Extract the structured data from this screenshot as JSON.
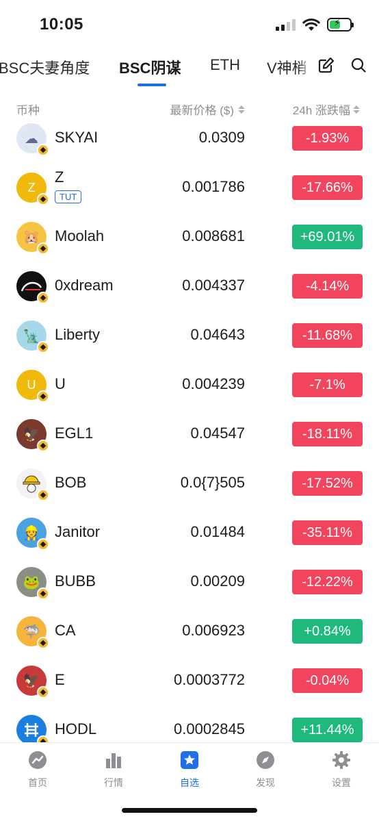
{
  "status_bar": {
    "time": "10:05",
    "battery_color": "#34c759"
  },
  "tabs": [
    {
      "label": "BSC夫妻角度",
      "active": false
    },
    {
      "label": "BSC阴谋",
      "active": true
    },
    {
      "label": "ETH",
      "active": false
    },
    {
      "label": "V神梢",
      "active": false
    }
  ],
  "tab_tools": {
    "edit_icon": "edit-icon",
    "search_icon": "search-icon"
  },
  "columns": {
    "coin": "币种",
    "price": "最新价格 ($)",
    "change": "24h 涨跌幅"
  },
  "coins": [
    {
      "name": "SKYAI",
      "price": "0.0309",
      "change": "-1.93%",
      "direction": "down",
      "avatar_color": "#dfe7f5"
    },
    {
      "name": "Z",
      "tag": "TUT",
      "price": "0.001786",
      "change": "-17.66%",
      "direction": "down",
      "avatar_color": "#f0b90b",
      "avatar_letter": "Z"
    },
    {
      "name": "Moolah",
      "price": "0.008681",
      "change": "+69.01%",
      "direction": "up",
      "avatar_color": "#f5c542"
    },
    {
      "name": "0xdream",
      "price": "0.004337",
      "change": "-4.14%",
      "direction": "down",
      "avatar_color": "#111111"
    },
    {
      "name": "Liberty",
      "price": "0.04643",
      "change": "-11.68%",
      "direction": "down",
      "avatar_color": "#a6d8ea"
    },
    {
      "name": "U",
      "price": "0.004239",
      "change": "-7.1%",
      "direction": "down",
      "avatar_color": "#f0b90b",
      "avatar_letter": "U"
    },
    {
      "name": "EGL1",
      "price": "0.04547",
      "change": "-18.11%",
      "direction": "down",
      "avatar_color": "#7a3b2e"
    },
    {
      "name": "BOB",
      "price": "0.0{7}505",
      "change": "-17.52%",
      "direction": "down",
      "avatar_color": "#f3f3f3"
    },
    {
      "name": "Janitor",
      "price": "0.01484",
      "change": "-35.11%",
      "direction": "down",
      "avatar_color": "#4aa3df"
    },
    {
      "name": "BUBB",
      "price": "0.00209",
      "change": "-12.22%",
      "direction": "down",
      "avatar_color": "#8a8f85"
    },
    {
      "name": "CA",
      "price": "0.006923",
      "change": "+0.84%",
      "direction": "up",
      "avatar_color": "#f5b43c"
    },
    {
      "name": "E",
      "price": "0.0003772",
      "change": "-0.04%",
      "direction": "down",
      "avatar_color": "#c63a3a"
    },
    {
      "name": "HODL",
      "price": "0.0002845",
      "change": "+11.44%",
      "direction": "up",
      "avatar_color": "#1a7fe0"
    }
  ],
  "colors": {
    "accent": "#1f6fe8",
    "negative": "#f2445c",
    "positive": "#1fb97e"
  },
  "bottom_nav": [
    {
      "label": "首页",
      "icon": "home-chart-icon",
      "active": false
    },
    {
      "label": "行情",
      "icon": "market-bars-icon",
      "active": false
    },
    {
      "label": "自选",
      "icon": "star-icon",
      "active": true
    },
    {
      "label": "发现",
      "icon": "compass-icon",
      "active": false
    },
    {
      "label": "设置",
      "icon": "settings-gear-icon",
      "active": false
    }
  ]
}
